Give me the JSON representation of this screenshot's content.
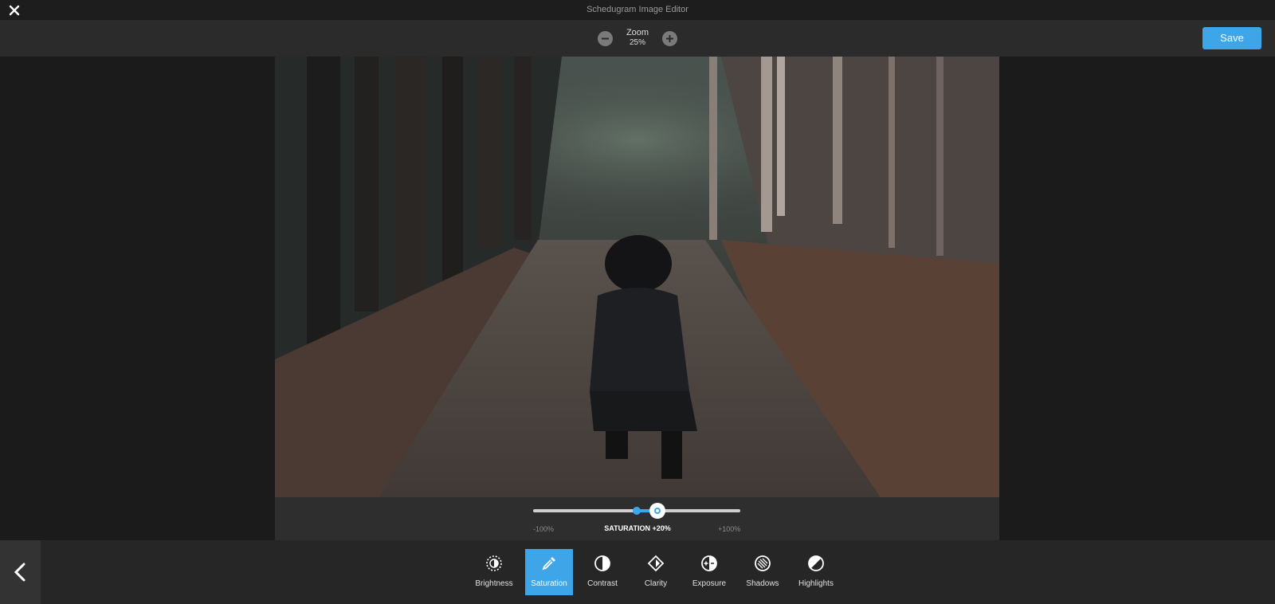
{
  "app": {
    "title": "Schedugram Image Editor"
  },
  "toolbar": {
    "zoom_label": "Zoom",
    "zoom_value": "25%",
    "save_label": "Save"
  },
  "slider": {
    "min_label": "-100%",
    "max_label": "+100%",
    "label": "SATURATION +20%",
    "value_percent": 20,
    "min": -100,
    "max": 100
  },
  "tools": [
    {
      "label": "Brightness",
      "icon": "brightness-icon",
      "active": false
    },
    {
      "label": "Saturation",
      "icon": "saturation-dropper-icon",
      "active": true
    },
    {
      "label": "Contrast",
      "icon": "contrast-icon",
      "active": false
    },
    {
      "label": "Clarity",
      "icon": "clarity-icon",
      "active": false
    },
    {
      "label": "Exposure",
      "icon": "exposure-icon",
      "active": false
    },
    {
      "label": "Shadows",
      "icon": "shadows-icon",
      "active": false
    },
    {
      "label": "Highlights",
      "icon": "highlights-icon",
      "active": false
    }
  ],
  "colors": {
    "accent": "#3da5e8",
    "background": "#1b1b1b",
    "toolbar": "#2b2b2b"
  }
}
